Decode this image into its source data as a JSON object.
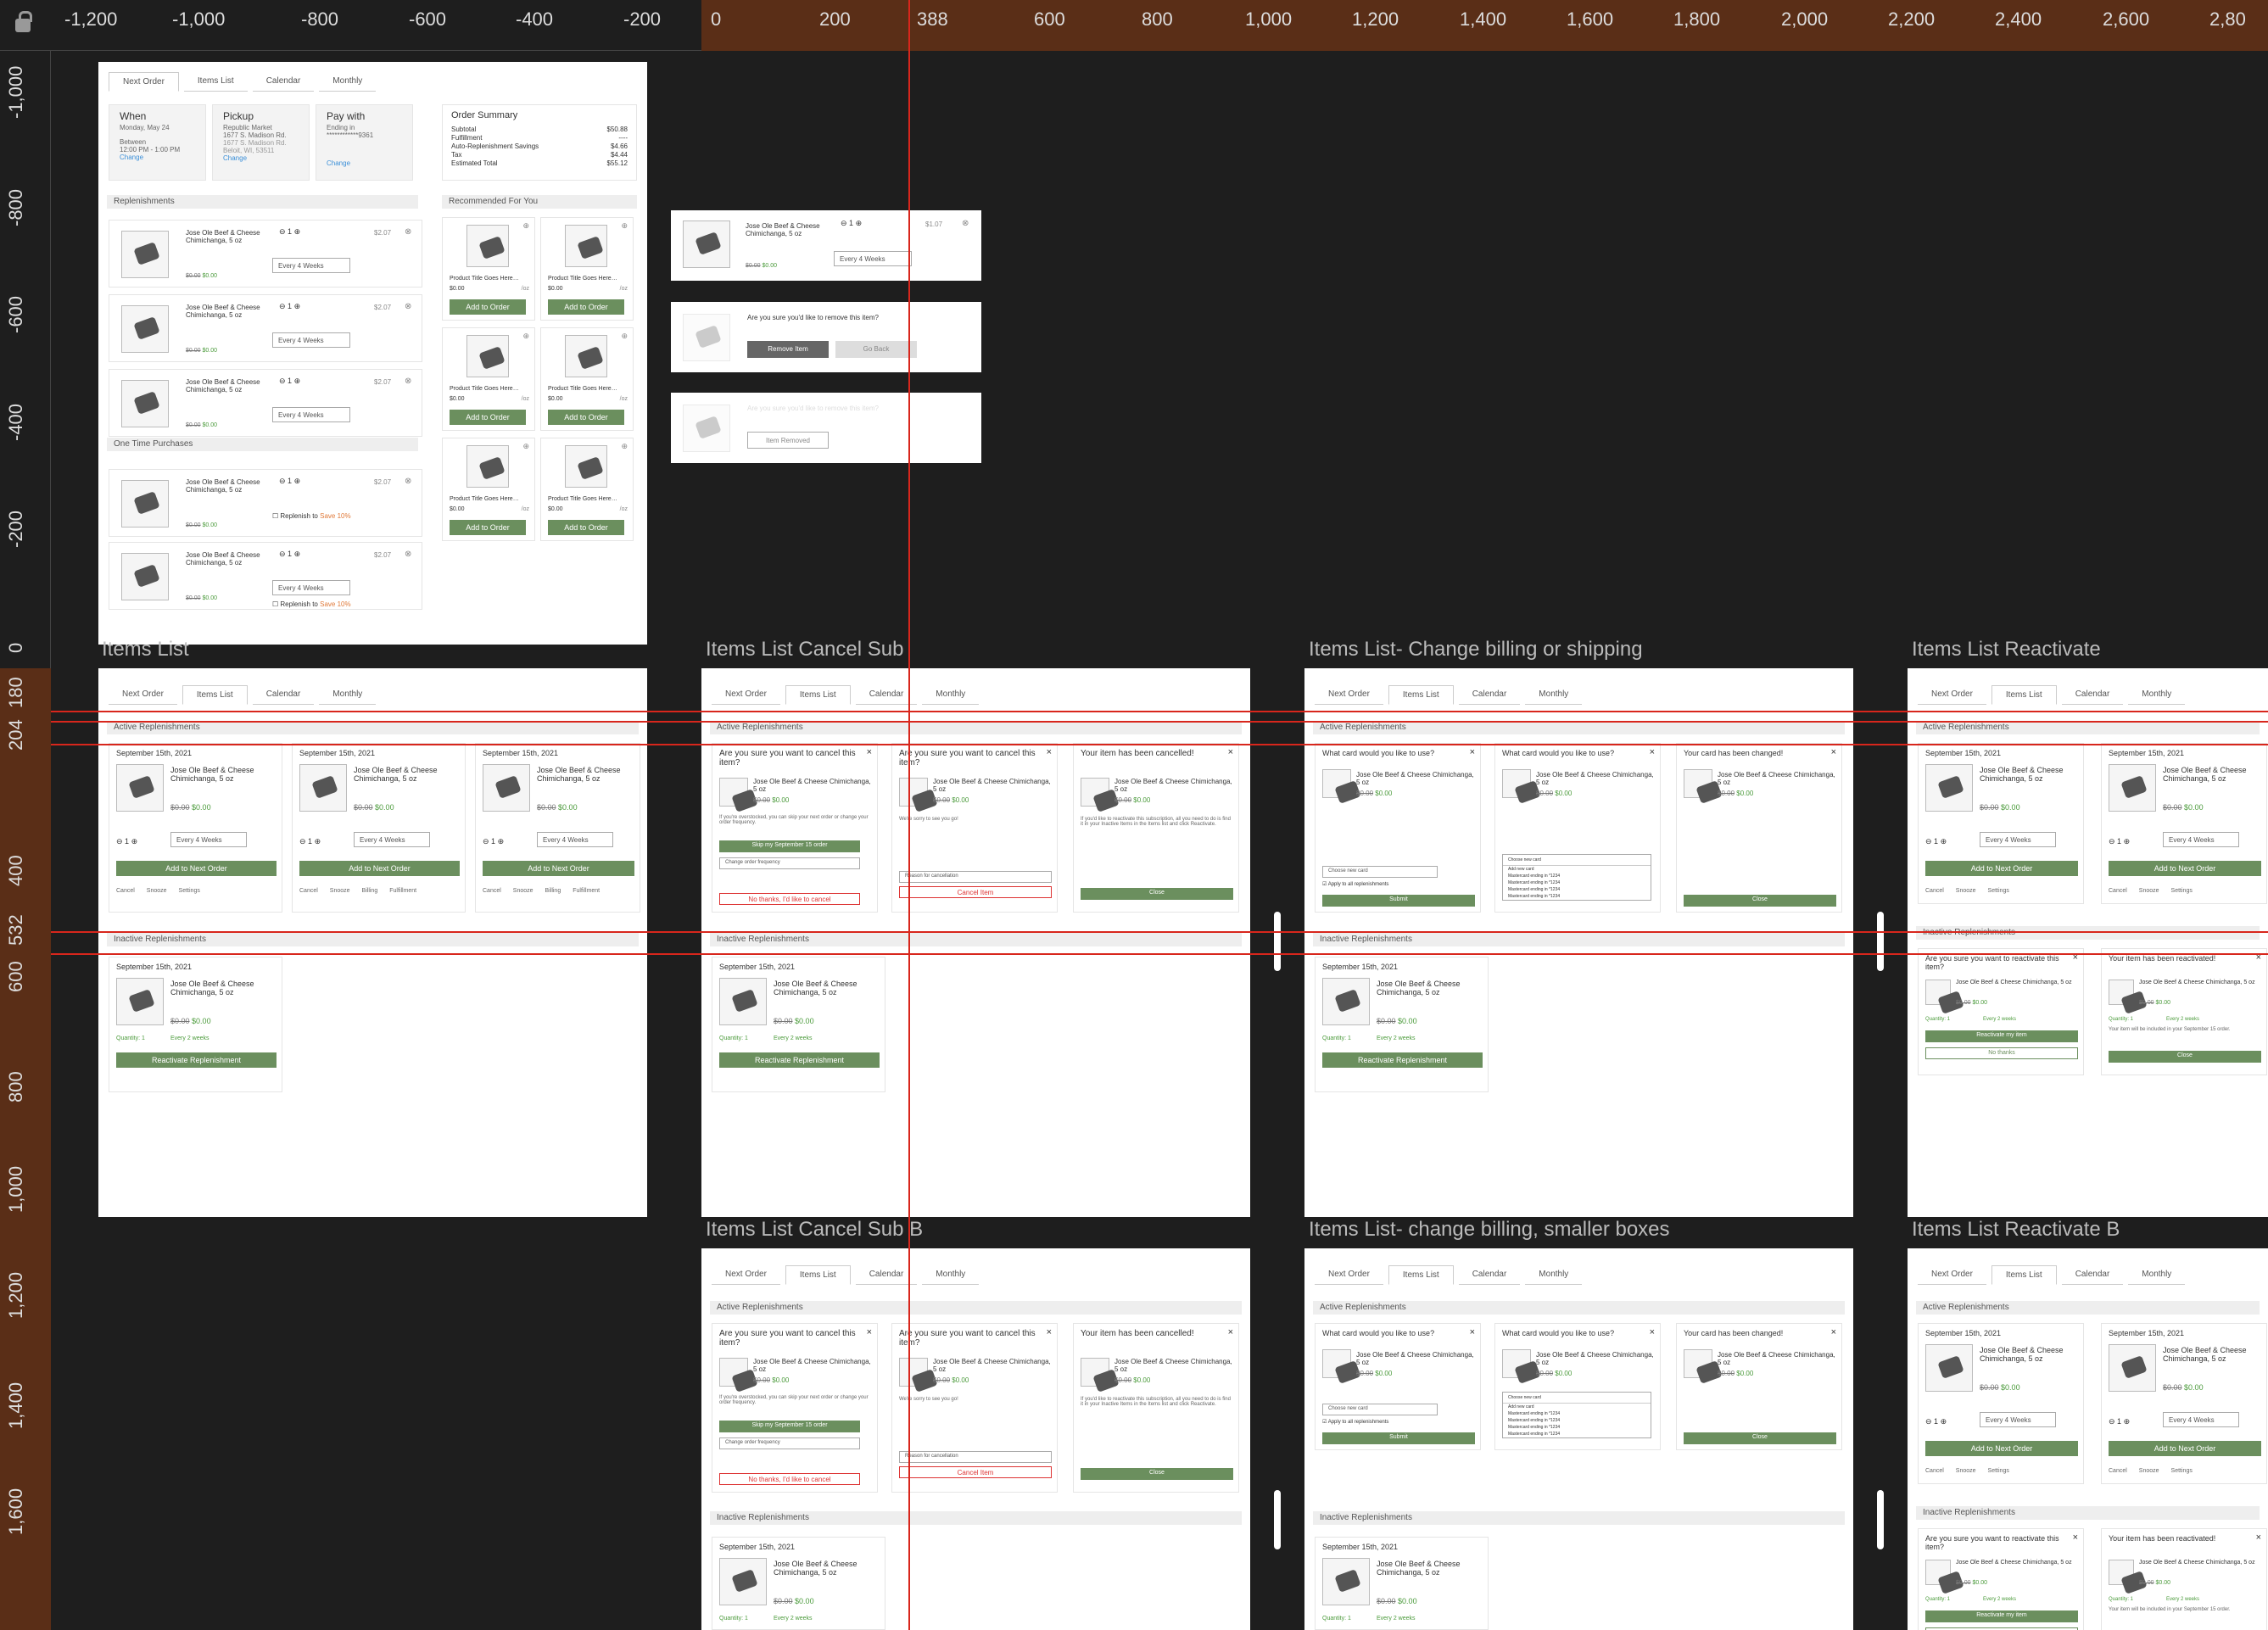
{
  "rulers": {
    "top": [
      "-1,200",
      "-1,000",
      "-800",
      "-600",
      "-400",
      "-200",
      "0",
      "200",
      "388",
      "600",
      "800",
      "1,000",
      "1,200",
      "1,400",
      "1,600",
      "1,800",
      "2,000",
      "2,200",
      "2,400",
      "2,600",
      "2,80"
    ],
    "left": [
      "-1,000",
      "-800",
      "-600",
      "-400",
      "-200",
      "0",
      "180",
      "204",
      "400",
      "532",
      "600",
      "800",
      "1,000",
      "1,200",
      "1,400",
      "1,600"
    ]
  },
  "frames": {
    "items_list": "Items List",
    "cancel_sub": "Items List Cancel Sub",
    "change_billing": "Items List- Change billing or shipping",
    "reactivate": "Items List Reactivate",
    "cancel_sub_b": "Items List Cancel Sub B",
    "change_billing_small": "Items List- change billing, smaller boxes",
    "reactivate_b": "Items List Reactivate B"
  },
  "tabs": [
    "Next Order",
    "Items List",
    "Calendar",
    "Monthly"
  ],
  "sections": {
    "active": "Active Replenishments",
    "inactive": "Inactive Replenishments",
    "replenishments": "Replenishments",
    "one_time": "One Time Purchases",
    "recommended": "Recommended For You"
  },
  "next_order": {
    "when_title": "When",
    "when_value": "Monday, May 24",
    "when_label": "Between",
    "when_time": "12:00 PM - 1:00 PM",
    "change": "Change",
    "pickup_title": "Pickup",
    "pickup_store": "Republic Market",
    "pickup_addr1": "1677 S. Madison Rd.",
    "pickup_addr1b": "1677 S. Madison Rd.",
    "pickup_addr2": "Beloit, WI, 53511",
    "pay_title": "Pay with",
    "pay_label": "Ending in",
    "pay_card": "************9361",
    "summary_title": "Order Summary",
    "summary_rows": [
      [
        "Subtotal",
        "$50.88"
      ],
      [
        "Fulfillment",
        "----"
      ],
      [
        "Auto-Replenishment Savings",
        "$4.66"
      ],
      [
        "Tax",
        "$4.44"
      ],
      [
        "Estimated Total",
        "$55.12"
      ]
    ]
  },
  "product": {
    "name": "Jose Ole Beef & Cheese Chimichanga, 5 oz",
    "old_price": "$0.00",
    "price": "$0.00",
    "qty": "1",
    "unit": "$2.07",
    "freq": "Every 4 Weeks",
    "replenish": "Replenish to",
    "save": "Save 10%"
  },
  "reco": {
    "title": "Product Title Goes Here…",
    "price": "$0.00",
    "unit": "/oz",
    "btn": "Add to Order"
  },
  "remove": {
    "question": "Are you sure you'd like to remove this item?",
    "remove_btn": "Remove Item",
    "back_btn": "Go Back",
    "removed": "Item Removed",
    "unit": "$1.07"
  },
  "card": {
    "date": "September 15th, 2021",
    "add_btn": "Add to Next Order",
    "actions": [
      "Cancel",
      "Snooze",
      "Billing",
      "Fulfillment"
    ],
    "actions_short": [
      "Cancel",
      "Snooze",
      "Settings"
    ],
    "quantity": "Quantity: 1",
    "every": "Every 2 weeks",
    "reactivate_btn": "Reactivate Replenishment"
  },
  "cancel": {
    "question": "Are you sure you want to cancel this item?",
    "hint": "If you're overstocked, you can skip your next order or change your order frequency.",
    "skip_btn": "Skip my September 15 order",
    "change_freq": "Change order frequency",
    "no_thanks": "No thanks, I'd like to cancel",
    "sorry": "We're sorry to see you go!",
    "reason": "Reason for cancellation",
    "cancel_btn": "Cancel Item",
    "cancelled": "Your item has been cancelled!",
    "reactivate_hint": "If you'd like to reactivate this subscription, all you need to do is find it in your Inactive Items in the Items list and click Reactivate.",
    "close": "Close"
  },
  "billing": {
    "question": "What card would you like to use?",
    "choose": "Choose new card",
    "apply_all": "Apply to all replenishments",
    "submit": "Submit",
    "changed": "Your card has been changed!",
    "options": [
      "Add new card",
      "Mastercard ending in *1234",
      "Mastercard ending in *1234",
      "Mastercard ending in *1234",
      "Mastercard ending in *1234"
    ],
    "ending": "Mastercard ending in *1234",
    "close": "Close"
  },
  "reactivate": {
    "question": "Are you sure you want to reactivate this item?",
    "btn": "Reactivate my item",
    "no": "No thanks",
    "done": "Your item has been reactivated!",
    "note": "Your item will be included in your September 15 order.",
    "close": "Close"
  }
}
